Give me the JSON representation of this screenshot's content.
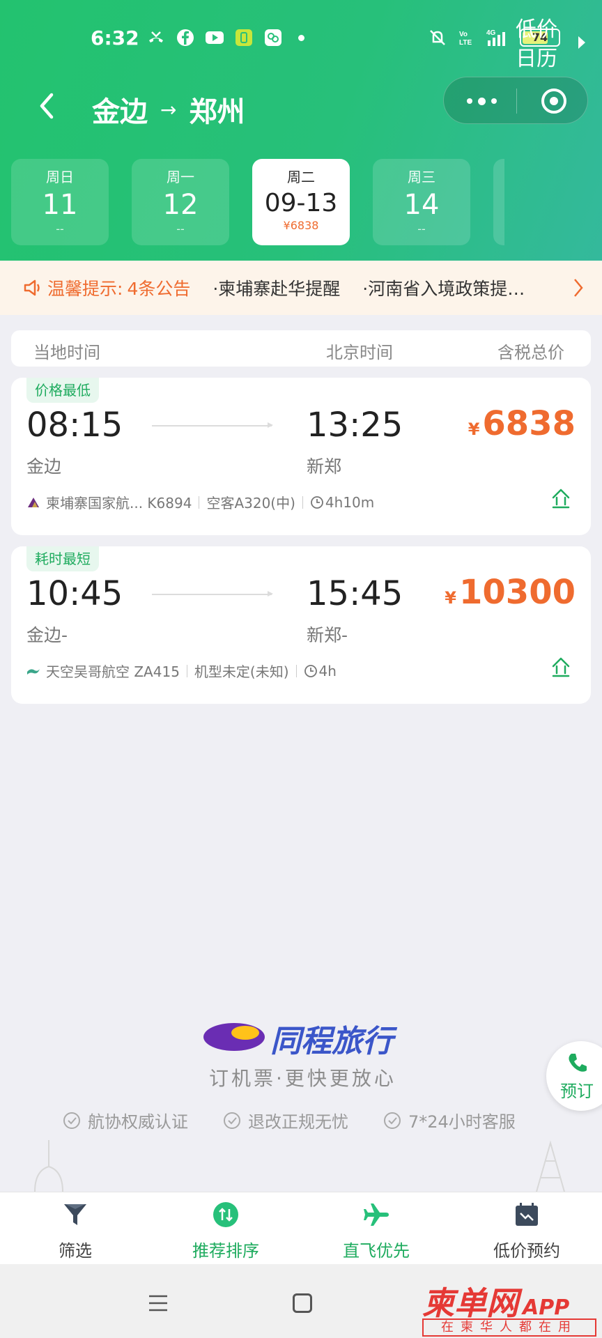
{
  "status_bar": {
    "time": "6:32",
    "battery": "74"
  },
  "header": {
    "from": "金边",
    "to": "郑州",
    "arrow": "→"
  },
  "dates": [
    {
      "weekday": "周日",
      "day": "11",
      "price": "--"
    },
    {
      "weekday": "周一",
      "day": "12",
      "price": "--"
    },
    {
      "weekday": "周二",
      "day": "09-13",
      "price": "¥6838",
      "active": true
    },
    {
      "weekday": "周三",
      "day": "14",
      "price": "--"
    }
  ],
  "low_price_calendar": {
    "line1": "低价",
    "line2": "日历"
  },
  "notice": {
    "label": "温馨提示:",
    "count": "4条公告",
    "items": [
      "·柬埔寨赴华提醒",
      "·河南省入境政策提…"
    ]
  },
  "columns": {
    "local_time": "当地时间",
    "beijing_time": "北京时间",
    "total_price": "含税总价"
  },
  "flights": [
    {
      "tag": "价格最低",
      "dep_time": "08:15",
      "arr_time": "13:25",
      "dep_city": "金边",
      "arr_city": "新郑",
      "price": "6838",
      "currency": "¥",
      "airline": "柬埔寨国家航... K6894",
      "aircraft": "空客A320(中)",
      "duration": "4h10m"
    },
    {
      "tag": "耗时最短",
      "dep_time": "10:45",
      "arr_time": "15:45",
      "dep_city": "金边-",
      "arr_city": "新郑-",
      "price": "10300",
      "currency": "¥",
      "airline": "天空吴哥航空 ZA415",
      "aircraft": "机型未定(未知)",
      "duration": "4h"
    }
  ],
  "brand": {
    "name": "同程旅行",
    "slogan": "订机票·更快更放心"
  },
  "badges": [
    "航协权威认证",
    "退改正规无忧",
    "7*24小时客服"
  ],
  "book_button": "预订",
  "bottom_bar": [
    {
      "label": "筛选",
      "icon": "filter-icon"
    },
    {
      "label": "推荐排序",
      "icon": "sort-icon"
    },
    {
      "label": "直飞优先",
      "icon": "plane-icon"
    },
    {
      "label": "低价预约",
      "icon": "calendar-icon"
    }
  ],
  "watermark": {
    "main": "柬单网",
    "sub": "APP",
    "tagline": "在柬华人都在用"
  },
  "colors": {
    "green": "#23c26f",
    "orange": "#ef6b2f",
    "tag_green": "#1eab5e"
  }
}
